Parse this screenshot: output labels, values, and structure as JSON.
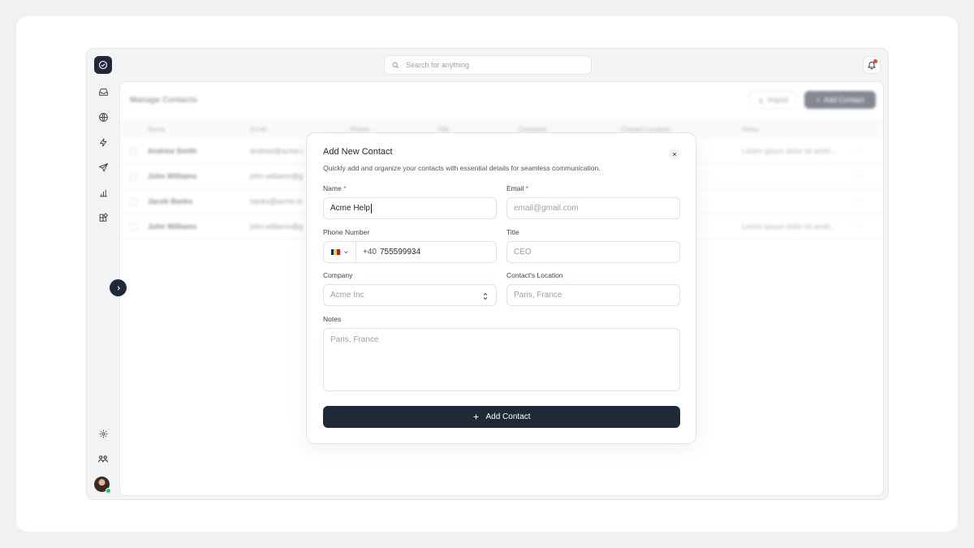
{
  "search": {
    "placeholder": "Search for anything"
  },
  "page": {
    "title": "Manage Contacts",
    "import_label": "Import",
    "add_label": "Add Contact"
  },
  "table": {
    "columns": [
      "Name",
      "Email",
      "Phone",
      "Title",
      "Company",
      "Contact Location",
      "Notes"
    ],
    "rows": [
      {
        "name": "Andrew Smith",
        "email": "andrew@acme.i",
        "notes": "Lorem ipsum dolor sit amet..."
      },
      {
        "name": "John Williams",
        "email": "john.williams@g",
        "notes": ""
      },
      {
        "name": "Jacob Banks",
        "email": "banks@acme.io",
        "notes": ""
      },
      {
        "name": "John Williams",
        "email": "john.williams@g",
        "notes": "Lorem ipsum dolor sit amet..."
      }
    ],
    "row_actions": "···"
  },
  "modal": {
    "title": "Add New Contact",
    "subtitle": "Quickly add and organize your contacts with essential details for seamless communication.",
    "name_label": "Name",
    "name_value": "Acme Help",
    "email_label": "Email",
    "email_placeholder": "email@gmail.com",
    "required_mark": "*",
    "phone_label": "Phone Number",
    "phone_code": "+40",
    "phone_value": "755599934",
    "title_label": "Title",
    "title_placeholder": "CEO",
    "company_label": "Company",
    "company_placeholder": "Acme Inc",
    "location_label": "Contact's Location",
    "location_placeholder": "Paris, France",
    "notes_label": "Notes",
    "notes_placeholder": "Paris, France",
    "submit_label": "Add Contact"
  },
  "colors": {
    "primary": "#1f2937",
    "required": "#ef4444",
    "online": "#22c55e",
    "notification": "#ef4444"
  }
}
